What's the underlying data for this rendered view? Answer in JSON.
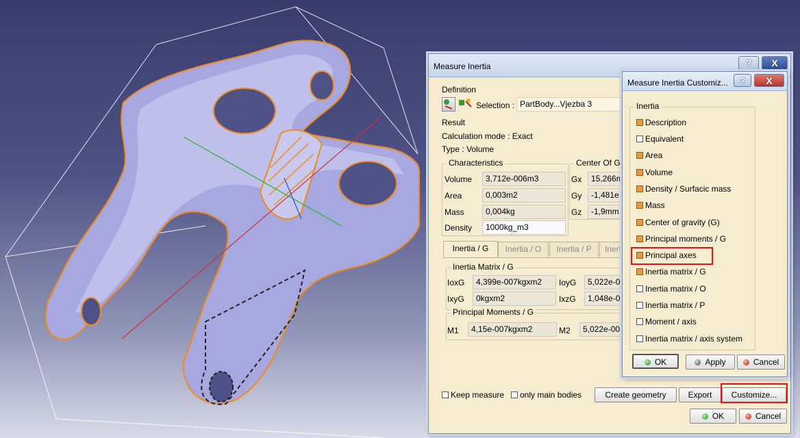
{
  "colors": {
    "dialog_bg": "#f6ecd0",
    "checkbox_on": "#e79a3c",
    "highlight_box": "#e01616",
    "part_surface": "#a7a8df",
    "part_edges": "#f08a1c",
    "viewport_top": "#3a3c6e"
  },
  "viewport": {
    "model_name": "connecting-rod-part"
  },
  "measure_dialog": {
    "title": "Measure Inertia",
    "help_label": "?",
    "close_label": "X",
    "definition_label": "Definition",
    "selection_label": "Selection :",
    "selection_value": "PartBody...Vjezba 3",
    "result_label": "Result",
    "calc_mode": "Calculation mode :  Exact",
    "type": "Type :  Volume",
    "characteristics": {
      "title": "Characteristics",
      "rows": [
        {
          "label": "Volume",
          "value": "3,712e-006m3"
        },
        {
          "label": "Area",
          "value": "0,003m2"
        },
        {
          "label": "Mass",
          "value": "0,004kg"
        },
        {
          "label": "Density",
          "value": "1000kg_m3"
        }
      ]
    },
    "center_of_gravity": {
      "title": "Center Of Gr",
      "rows": [
        {
          "label": "Gx",
          "value": "15,266m"
        },
        {
          "label": "Gy",
          "value": "-1,481e"
        },
        {
          "label": "Gz",
          "value": "-1,9mm"
        }
      ]
    },
    "tabs": [
      "Inertia / G",
      "Inertia / O",
      "Inertia / P",
      "Inert"
    ],
    "inertia_matrix": {
      "title": "Inertia Matrix / G",
      "cells": [
        {
          "label": "IoxG",
          "value": "4,399e-007kgxm2"
        },
        {
          "label": "IoyG",
          "value": "5,022e-0"
        },
        {
          "label": "IxyG",
          "value": "0kgxm2"
        },
        {
          "label": "IxzG",
          "value": "1,048e-0"
        }
      ]
    },
    "principal_moments": {
      "title": "Principal Moments / G",
      "cells": [
        {
          "label": "M1",
          "value": "4,15e-007kgxm2"
        },
        {
          "label": "M2",
          "value": "5,022e-00"
        }
      ]
    },
    "keep_measure_label": "Keep measure",
    "only_main_bodies_label": "only main bodies",
    "create_geometry_label": "Create geometry",
    "export_label": "Export",
    "customize_label": "Customize...",
    "ok_label": "OK",
    "cancel_label": "Cancel"
  },
  "customize_dialog": {
    "title": "Measure Inertia Customiz...",
    "help_label": "?",
    "close_label": "X",
    "group_title": "Inertia",
    "items": [
      {
        "label": "Description",
        "checked": true
      },
      {
        "label": "Equivalent",
        "checked": false
      },
      {
        "label": "Area",
        "checked": true
      },
      {
        "label": "Volume",
        "checked": true
      },
      {
        "label": "Density / Surfacic mass",
        "checked": true
      },
      {
        "label": "Mass",
        "checked": true
      },
      {
        "label": "Center of gravity (G)",
        "checked": true
      },
      {
        "label": "Principal moments / G",
        "checked": true
      },
      {
        "label": "Principal axes",
        "checked": true
      },
      {
        "label": "Inertia matrix / G",
        "checked": true
      },
      {
        "label": "Inertia matrix / O",
        "checked": false
      },
      {
        "label": "Inertia matrix / P",
        "checked": false
      },
      {
        "label": "Moment / axis",
        "checked": false
      },
      {
        "label": "Inertia matrix / axis system",
        "checked": false
      }
    ],
    "ok_label": "OK",
    "apply_label": "Apply",
    "cancel_label": "Cancel"
  }
}
